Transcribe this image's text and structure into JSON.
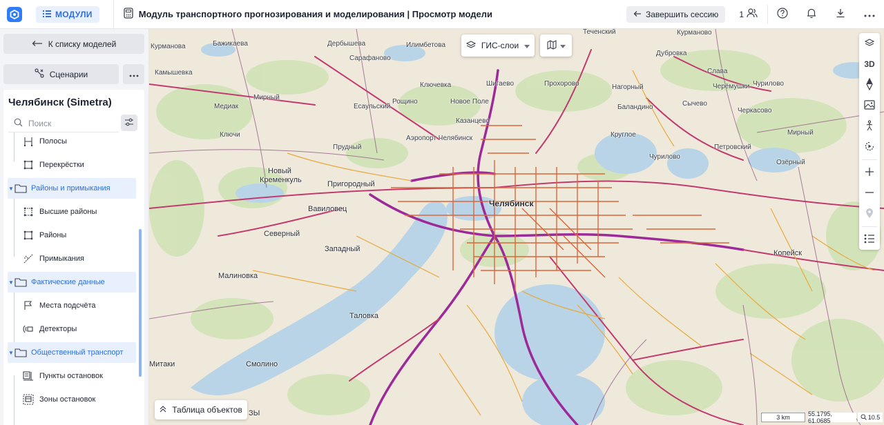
{
  "header": {
    "modules_label": "МОДУЛИ",
    "title": "Модуль транспортного прогнозирования и моделирования | Просмотр модели",
    "end_session_label": "Завершить сессию",
    "users_count": "1"
  },
  "sidebar": {
    "back_label": "К списку моделей",
    "scenarios_label": "Сценарии",
    "model_title": "Челябинск (Simetra)",
    "search_placeholder": "Поиск",
    "tree": [
      {
        "label": "Полосы",
        "type": "leaf",
        "icon": "lanes-icon"
      },
      {
        "label": "Перекрёстки",
        "type": "leaf",
        "icon": "intersections-icon"
      },
      {
        "label": "Районы и примыкания",
        "type": "group",
        "icon": "folder-icon"
      },
      {
        "label": "Высшие районы",
        "type": "leaf",
        "icon": "super-zones-icon"
      },
      {
        "label": "Районы",
        "type": "leaf",
        "icon": "zones-icon"
      },
      {
        "label": "Примыкания",
        "type": "leaf",
        "icon": "connectors-icon"
      },
      {
        "label": "Фактические данные",
        "type": "group",
        "icon": "folder-icon"
      },
      {
        "label": "Места подсчёта",
        "type": "leaf",
        "icon": "flag-icon"
      },
      {
        "label": "Детекторы",
        "type": "leaf",
        "icon": "detector-icon"
      },
      {
        "label": "Общественный транспорт",
        "type": "group",
        "icon": "folder-icon"
      },
      {
        "label": "Пункты остановок",
        "type": "leaf",
        "icon": "stop-points-icon"
      },
      {
        "label": "Зоны остановок",
        "type": "leaf",
        "icon": "stop-zones-icon"
      }
    ]
  },
  "map": {
    "gis_label": "ГИС-слои",
    "table_label": "Таблица объектов",
    "scale_label": "3 km",
    "coords_label": "55.1795, 61.0685",
    "zoom_label": "10.5",
    "tool_3d_label": "3D",
    "places": [
      {
        "name": "Челябинск",
        "cls": "big"
      },
      {
        "name": "Копейск",
        "cls": "mid"
      },
      {
        "name": "Смолино",
        "cls": "mid"
      },
      {
        "name": "Таловка",
        "cls": "mid"
      },
      {
        "name": "Малиновка",
        "cls": "mid"
      },
      {
        "name": "Северный",
        "cls": "mid"
      },
      {
        "name": "Западный",
        "cls": "mid"
      },
      {
        "name": "Вавиловец",
        "cls": "mid"
      },
      {
        "name": "Пригородный",
        "cls": "mid"
      },
      {
        "name": "Новый",
        "cls": "mid"
      },
      {
        "name": "Кременкуль",
        "cls": "mid"
      },
      {
        "name": "Прудный",
        "cls": ""
      },
      {
        "name": "Ключи",
        "cls": ""
      },
      {
        "name": "Медиак",
        "cls": ""
      },
      {
        "name": "Мирный",
        "cls": ""
      },
      {
        "name": "Есаульский",
        "cls": ""
      },
      {
        "name": "Рощино",
        "cls": ""
      },
      {
        "name": "Новое Поле",
        "cls": ""
      },
      {
        "name": "Казанцево",
        "cls": ""
      },
      {
        "name": "Шигаево",
        "cls": ""
      },
      {
        "name": "Прохорово",
        "cls": ""
      },
      {
        "name": "Нагорный",
        "cls": ""
      },
      {
        "name": "Баландино",
        "cls": ""
      },
      {
        "name": "Сычево",
        "cls": ""
      },
      {
        "name": "Черкасово",
        "cls": ""
      },
      {
        "name": "Круглое",
        "cls": ""
      },
      {
        "name": "Чурилово",
        "cls": ""
      },
      {
        "name": "Петровский",
        "cls": ""
      },
      {
        "name": "Мирный",
        "cls": ""
      },
      {
        "name": "Озёрный",
        "cls": ""
      },
      {
        "name": "Слава",
        "cls": ""
      },
      {
        "name": "Черёмушки",
        "cls": ""
      },
      {
        "name": "Чурилово",
        "cls": ""
      },
      {
        "name": "Дубровка",
        "cls": ""
      },
      {
        "name": "Курманово",
        "cls": ""
      },
      {
        "name": "Теченский",
        "cls": ""
      },
      {
        "name": "Курманова",
        "cls": ""
      },
      {
        "name": "Бажикаева",
        "cls": ""
      },
      {
        "name": "Камышевка",
        "cls": ""
      },
      {
        "name": "Дербышева",
        "cls": ""
      },
      {
        "name": "Илимбетова",
        "cls": ""
      },
      {
        "name": "Ключевка",
        "cls": ""
      },
      {
        "name": "Сарафаново",
        "cls": ""
      },
      {
        "name": "Аэропорт Челябинск",
        "cls": ""
      },
      {
        "name": "Митаки",
        "cls": "mid"
      },
      {
        "name": "ЗЫ",
        "cls": "mid"
      }
    ]
  }
}
